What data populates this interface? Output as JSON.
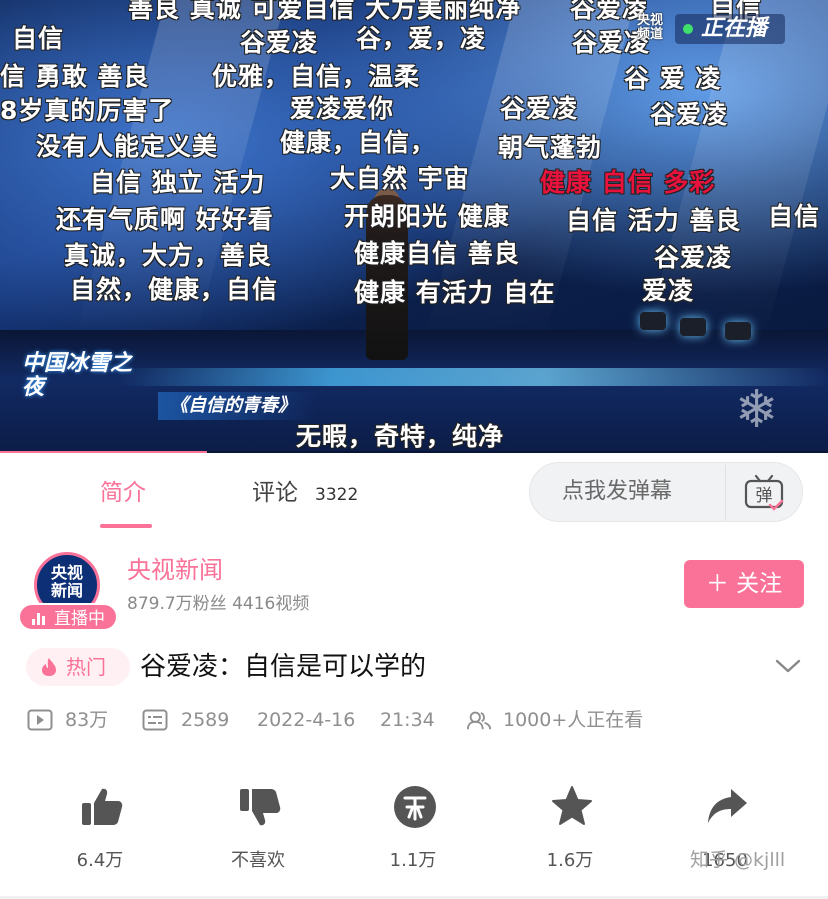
{
  "video": {
    "live_logo": {
      "cctv": "央视",
      "cctv_sub": "频道",
      "live": "正在播"
    },
    "show_logo": "中国冰雪之夜",
    "show_title": "《自信的青春》",
    "progress_fraction": 0.25,
    "danmaku": [
      {
        "text": "善良 真诚 可爱自信 大方美丽纯净",
        "red": false
      },
      {
        "text": "谷爱凌",
        "red": false
      },
      {
        "text": "自信",
        "red": false
      },
      {
        "text": "自信",
        "red": false
      },
      {
        "text": "谷爱凌",
        "red": false
      },
      {
        "text": "谷，爱，凌",
        "red": false
      },
      {
        "text": "谷爱凌",
        "red": false
      },
      {
        "text": "信 勇敢 善良",
        "red": false
      },
      {
        "text": "优雅，自信，温柔",
        "red": false
      },
      {
        "text": "谷 爱 凌",
        "red": false
      },
      {
        "text": "8岁真的厉害了",
        "red": false
      },
      {
        "text": "爱凌爱你",
        "red": false
      },
      {
        "text": "谷爱凌",
        "red": false
      },
      {
        "text": "谷爱凌",
        "red": false
      },
      {
        "text": "没有人能定义美",
        "red": false
      },
      {
        "text": "健康，自信，",
        "red": false
      },
      {
        "text": "朝气蓬勃",
        "red": false
      },
      {
        "text": "自信 独立 活力",
        "red": false
      },
      {
        "text": "大自然 宇宙",
        "red": false
      },
      {
        "text": "健康 自信 多彩",
        "red": true
      },
      {
        "text": "还有气质啊 好好看",
        "red": false
      },
      {
        "text": "开朗阳光 健康",
        "red": false
      },
      {
        "text": "自信 活力 善良",
        "red": false
      },
      {
        "text": "自信",
        "red": false
      },
      {
        "text": "真诚，大方，善良",
        "red": false
      },
      {
        "text": "健康自信 善良",
        "red": false
      },
      {
        "text": "谷爱凌",
        "red": false
      },
      {
        "text": "自然，健康，自信",
        "red": false
      },
      {
        "text": "健康 有活力 自在",
        "red": false
      },
      {
        "text": "爱凌",
        "red": false
      },
      {
        "text": "无暇，奇特，纯净",
        "red": false
      }
    ]
  },
  "tabs": {
    "intro": "简介",
    "comments": "评论",
    "comments_count": "3322",
    "danmaku_placeholder": "点我发弹幕",
    "danmaku_icon_char": "弹"
  },
  "uploader": {
    "avatar_text_1": "央视",
    "avatar_text_2": "新闻",
    "name": "央视新闻",
    "stats": "879.7万粉丝    4416视频",
    "live_badge": "直播中",
    "follow": "＋ 关注"
  },
  "video_info": {
    "hot_tag": "热门",
    "title": "谷爱凌：自信是可以学的",
    "views": "83万",
    "danmaku_count": "2589",
    "date": "2022-4-16",
    "time": "21:34",
    "watching": "1000+人正在看"
  },
  "actions": {
    "like": "6.4万",
    "dislike": "不喜欢",
    "coin": "1.1万",
    "favorite": "1.6万",
    "share": "1650"
  },
  "watermark": "知乎 @kjlll",
  "colors": {
    "accent": "#fb7299",
    "text": "#111111",
    "muted": "#8f8f8f"
  },
  "icons": [
    "play-count-icon",
    "danmaku-count-icon",
    "watching-icon",
    "like-icon",
    "dislike-icon",
    "coin-icon",
    "favorite-icon",
    "share-icon",
    "chevron-down-icon",
    "flame-icon",
    "danmaku-send-icon"
  ]
}
